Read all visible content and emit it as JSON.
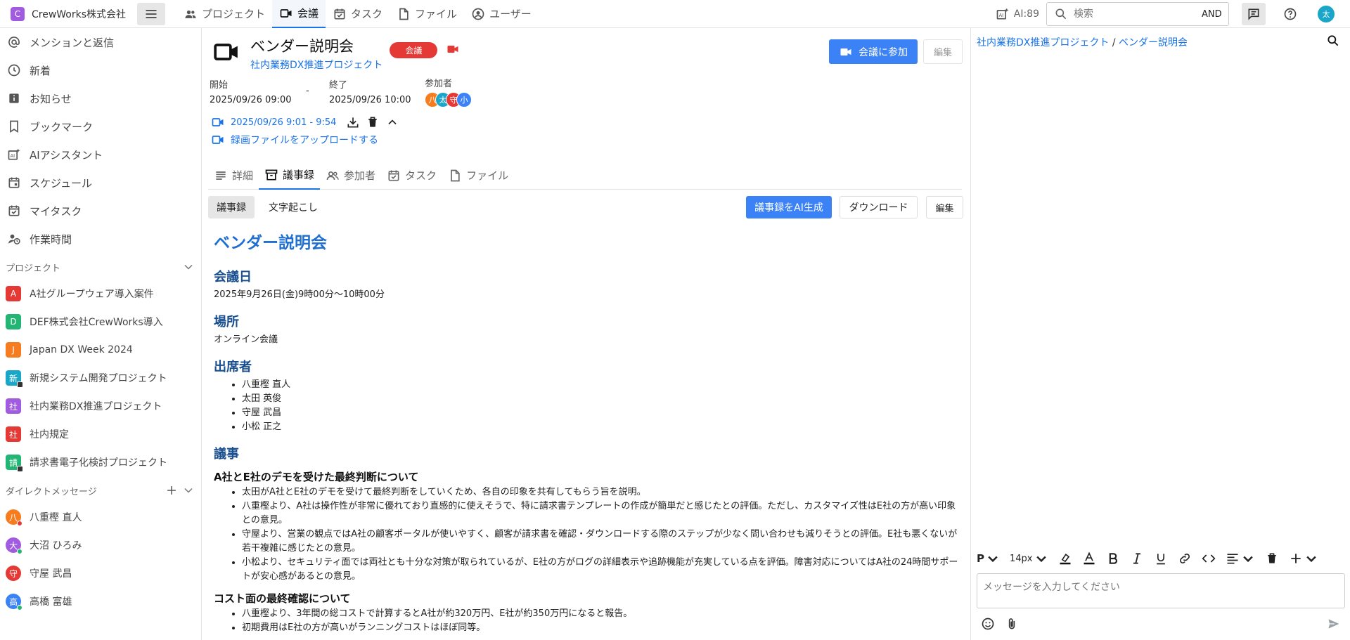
{
  "app": {
    "brand_name": "CrewWorks株式会社",
    "brand_logo": "C",
    "ai_count": "AI:89"
  },
  "nav": {
    "tabs": [
      {
        "label": "プロジェクト",
        "icon": "people-icon"
      },
      {
        "label": "会議",
        "icon": "video-icon",
        "active": true
      },
      {
        "label": "タスク",
        "icon": "calendar-check-icon"
      },
      {
        "label": "ファイル",
        "icon": "file-icon"
      },
      {
        "label": "ユーザー",
        "icon": "user-circle-icon"
      }
    ]
  },
  "search": {
    "placeholder": "検索",
    "mode": "AND"
  },
  "user": {
    "avatar_initial": "太",
    "avatar_color": "#1aa6c8"
  },
  "sidebar": {
    "items": [
      {
        "label": "メンションと返信",
        "icon": "at-icon"
      },
      {
        "label": "新着",
        "icon": "clock-icon"
      },
      {
        "label": "お知らせ",
        "icon": "info-icon"
      },
      {
        "label": "ブックマーク",
        "icon": "bookmark-icon"
      },
      {
        "label": "AIアシスタント",
        "icon": "ai-icon"
      },
      {
        "label": "スケジュール",
        "icon": "calendar-icon"
      },
      {
        "label": "マイタスク",
        "icon": "calendar-check-icon"
      },
      {
        "label": "作業時間",
        "icon": "user-clock-icon"
      }
    ],
    "projects_header": "プロジェクト",
    "projects": [
      {
        "initial": "A",
        "label": "A社グループウェア導入案件",
        "color": "#e53935"
      },
      {
        "initial": "D",
        "label": "DEF株式会社CrewWorks導入",
        "color": "#22b573"
      },
      {
        "initial": "J",
        "label": "Japan DX Week 2024",
        "color": "#f57c1f"
      },
      {
        "initial": "新",
        "label": "新規システム開発プロジェクト",
        "color": "#1aa6c8",
        "locked": true
      },
      {
        "initial": "社",
        "label": "社内業務DX推進プロジェクト",
        "color": "#a05be0"
      },
      {
        "initial": "社",
        "label": "社内規定",
        "color": "#e53935"
      },
      {
        "initial": "請",
        "label": "請求書電子化検討プロジェクト",
        "color": "#22b573",
        "locked": true
      }
    ],
    "dm_header": "ダイレクトメッセージ",
    "dms": [
      {
        "initial": "八",
        "label": "八重樫 直人",
        "color": "#f57c1f",
        "status": "#e53935"
      },
      {
        "initial": "大",
        "label": "大沼 ひろみ",
        "color": "#a05be0",
        "status": "#22b573"
      },
      {
        "initial": "守",
        "label": "守屋 武昌",
        "color": "#e53935",
        "status": ""
      },
      {
        "initial": "高",
        "label": "高橋 富雄",
        "color": "#3b82f6",
        "status": "#22b573"
      }
    ]
  },
  "meeting": {
    "title": "ベンダー説明会",
    "project": "社内業務DX推進プロジェクト",
    "type_badge": "会議",
    "join_label": "会議に参加",
    "edit_label": "編集",
    "start_label": "開始",
    "start_value": "2025/09/26 09:00",
    "dash": "-",
    "end_label": "終了",
    "end_value": "2025/09/26 10:00",
    "participants_label": "参加者",
    "participants": [
      {
        "initial": "八",
        "color": "#f57c1f"
      },
      {
        "initial": "太",
        "color": "#1aa6c8"
      },
      {
        "initial": "守",
        "color": "#e53935"
      },
      {
        "initial": "小",
        "color": "#3b82f6"
      }
    ],
    "recording": "2025/09/26 9:01 - 9:54",
    "upload_label": "録画ファイルをアップロードする"
  },
  "tabs": [
    {
      "label": "詳細",
      "icon": "list-icon"
    },
    {
      "label": "議事録",
      "icon": "archive-icon",
      "active": true
    },
    {
      "label": "参加者",
      "icon": "people-icon"
    },
    {
      "label": "タスク",
      "icon": "calendar-check-icon"
    },
    {
      "label": "ファイル",
      "icon": "file-icon"
    }
  ],
  "subtabs": [
    {
      "label": "議事録",
      "active": true
    },
    {
      "label": "文字起こし"
    }
  ],
  "doc_actions": {
    "ai_generate": "議事録をAI生成",
    "download": "ダウンロード",
    "edit": "編集"
  },
  "minutes": {
    "title": "ベンダー説明会",
    "date_heading": "会議日",
    "date_text": "2025年9月26日(金)9時00分～10時00分",
    "place_heading": "場所",
    "place_text": "オンライン会議",
    "attendees_heading": "出席者",
    "attendees": [
      "八重樫 直人",
      "太田 英俊",
      "守屋 武昌",
      "小松 正之"
    ],
    "agenda_heading": "議事",
    "topic1": "A社とE社のデモを受けた最終判断について",
    "topic1_points": [
      "太田がA社とE社のデモを受けて最終判断をしていくため、各自の印象を共有してもらう旨を説明。",
      "八重樫より、A社は操作性が非常に優れており直感的に使えそうで、特に請求書テンプレートの作成が簡単だと感じたとの評価。ただし、カスタマイズ性はE社の方が高い印象との意見。",
      "守屋より、営業の観点ではA社の顧客ポータルが使いやすく、顧客が請求書を確認・ダウンロードする際のステップが少なく問い合わせも減りそうとの評価。E社も悪くないが若干複雑に感じたとの意見。",
      "小松より、セキュリティ面では両社とも十分な対策が取られているが、E社の方がログの詳細表示や追跡機能が充実している点を評価。障害対応についてはA社の24時間サポートが安心感があるとの意見。"
    ],
    "topic2": "コスト面の最終確認について",
    "topic2_points": [
      "八重樫より、3年間の総コストで計算するとA社が約320万円、E社が約350万円になると報告。",
      "初期費用はE社の方が高いがランニングコストはほぼ同等。"
    ]
  },
  "right_panel": {
    "breadcrumb_project": "社内業務DX推進プロジェクト",
    "breadcrumb_sep": " / ",
    "breadcrumb_page": "ベンダー説明会",
    "font_style": "P",
    "font_size": "14px",
    "message_placeholder": "メッセージを入力してください"
  }
}
